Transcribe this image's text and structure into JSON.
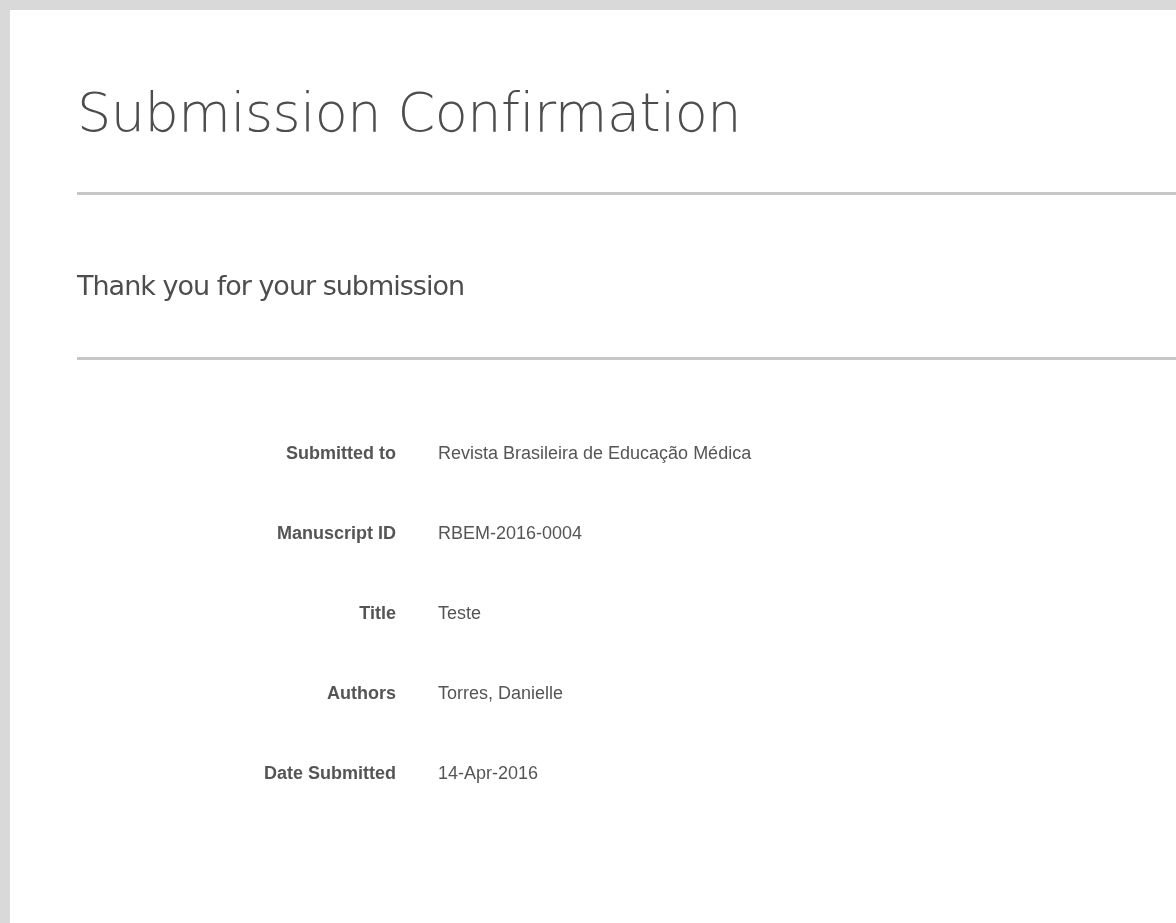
{
  "page": {
    "title": "Submission Confirmation",
    "subtitle": "Thank you for your submission"
  },
  "details": [
    {
      "label": "Submitted to",
      "value": "Revista Brasileira de Educação Médica"
    },
    {
      "label": "Manuscript ID",
      "value": "RBEM-2016-0004"
    },
    {
      "label": "Title",
      "value": "Teste"
    },
    {
      "label": "Authors",
      "value": "Torres, Danielle"
    },
    {
      "label": "Date Submitted",
      "value": "14-Apr-2016"
    }
  ]
}
